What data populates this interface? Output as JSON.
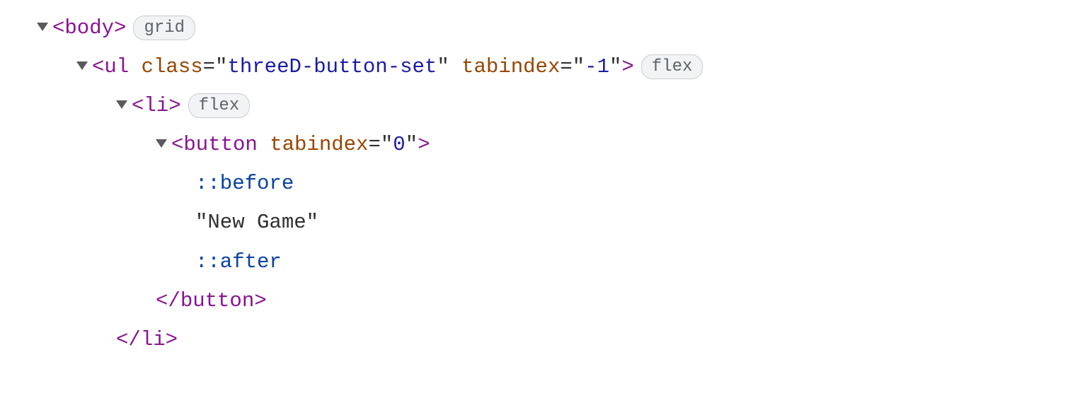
{
  "dom": {
    "body": {
      "open_bracket": "<",
      "tag": "body",
      "close_bracket": ">",
      "badge": "grid"
    },
    "ul": {
      "open_bracket": "<",
      "tag": "ul",
      "attr1_name": "class",
      "attr1_eq": "=\"",
      "attr1_value": "threeD-button-set",
      "attr1_end": "\"",
      "attr2_name": "tabindex",
      "attr2_eq": "=\"",
      "attr2_value": "-1",
      "attr2_end": "\"",
      "close_bracket": ">",
      "badge": "flex"
    },
    "li": {
      "open_bracket": "<",
      "tag": "li",
      "close_bracket": ">",
      "badge": "flex",
      "close_open_bracket": "</",
      "close_tag": "li",
      "close_close_bracket": ">"
    },
    "button": {
      "open_bracket": "<",
      "tag": "button",
      "attr1_name": "tabindex",
      "attr1_eq": "=\"",
      "attr1_value": "0",
      "attr1_end": "\"",
      "close_bracket": ">",
      "close_open_bracket": "</",
      "close_tag": "button",
      "close_close_bracket": ">"
    },
    "pseudo_before": "::before",
    "text_content": "\"New Game\"",
    "pseudo_after": "::after"
  }
}
